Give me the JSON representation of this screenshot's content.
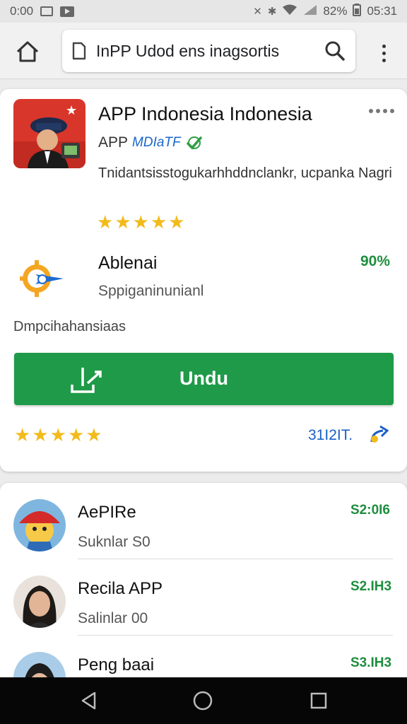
{
  "status_bar": {
    "time": "0:00",
    "battery_pct": "82%",
    "clock": "05:31",
    "icons": [
      "gallery-icon",
      "play-icon",
      "mute-icon",
      "vibrate-icon",
      "wifi-icon",
      "signal-icon",
      "battery-icon"
    ]
  },
  "browser": {
    "url": "InPP Udod ens inagsortis",
    "icons": [
      "home-icon",
      "page-icon",
      "search-icon",
      "more-vert-icon"
    ]
  },
  "app": {
    "title": "APP Indonesia Indonesia",
    "developer": "APP",
    "developer_badge": "MDIaTF",
    "description": "Tnidantsisstogukarhhddnclankr, ucpanka Nagri",
    "rating_stars": 4.5
  },
  "feature": {
    "title": "Ablenai",
    "percent": "90%",
    "subtitle": "Sppiganinunianl"
  },
  "section_label": "Dmpcihahansiaas",
  "install": {
    "label": "Undu",
    "color": "#1f9a48"
  },
  "footer": {
    "rating_stars": 4.5,
    "rating_count": "31I2IT."
  },
  "list": [
    {
      "title": "AePIRe",
      "subtitle": "Suknlar S0",
      "price": "S2:0I6"
    },
    {
      "title": "Recila APP",
      "subtitle": "Salinlar 00",
      "price": "S2.IH3"
    },
    {
      "title": "Peng baai",
      "subtitle": "",
      "price": "S3.IH3"
    }
  ],
  "colors": {
    "accent_green": "#1f9a48",
    "price_green": "#1e8e3e",
    "link_blue": "#1a5fc9",
    "star": "#f2bb1c"
  }
}
